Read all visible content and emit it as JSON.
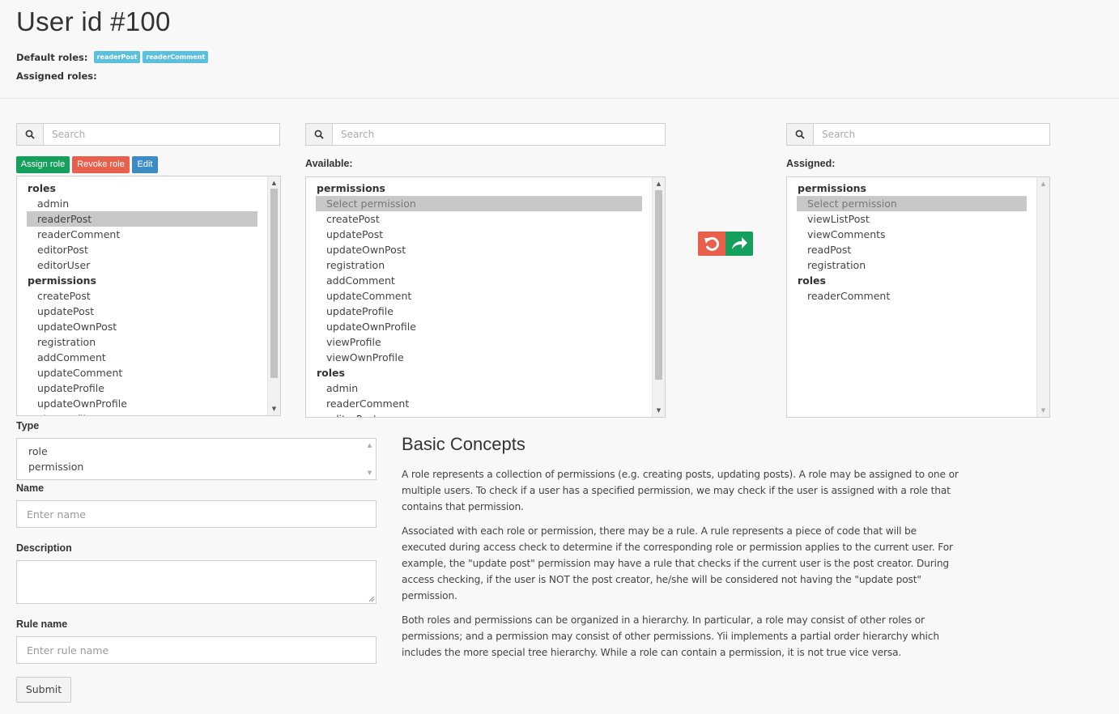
{
  "page": {
    "title": "User id #100",
    "default_roles_label": "Default roles:",
    "default_roles": [
      "readerPost",
      "readerComment"
    ],
    "assigned_roles_label": "Assigned roles:"
  },
  "left_panel": {
    "search_placeholder": "Search",
    "buttons": {
      "assign": "Assign role",
      "revoke": "Revoke role",
      "edit": "Edit"
    },
    "groups": [
      {
        "label": "roles",
        "items": [
          "admin",
          "readerPost",
          "readerComment",
          "editorPost",
          "editorUser"
        ],
        "selected": "readerPost"
      },
      {
        "label": "permissions",
        "items": [
          "createPost",
          "updatePost",
          "updateOwnPost",
          "registration",
          "addComment",
          "updateComment",
          "updateProfile",
          "updateOwnProfile",
          "viewProfile"
        ]
      }
    ]
  },
  "available_panel": {
    "search_placeholder": "Search",
    "label": "Available:",
    "groups": [
      {
        "label": "permissions",
        "items": [
          "Select permission",
          "createPost",
          "updatePost",
          "updateOwnPost",
          "registration",
          "addComment",
          "updateComment",
          "updateProfile",
          "updateOwnProfile",
          "viewProfile",
          "viewOwnProfile"
        ],
        "selected": "Select permission"
      },
      {
        "label": "roles",
        "items": [
          "admin",
          "readerComment",
          "editorPost"
        ]
      }
    ]
  },
  "assigned_panel": {
    "search_placeholder": "Search",
    "label": "Assigned:",
    "groups": [
      {
        "label": "permissions",
        "items": [
          "Select permission",
          "viewListPost",
          "viewComments",
          "readPost",
          "registration"
        ],
        "selected": "Select permission"
      },
      {
        "label": "roles",
        "items": [
          "readerComment"
        ]
      }
    ]
  },
  "transfer": {
    "revoke_icon": "undo-icon",
    "assign_icon": "share-forward-icon",
    "revoke_color": "#e8604c",
    "assign_color": "#16a05d"
  },
  "form": {
    "type_label": "Type",
    "type_options": [
      "role",
      "permission"
    ],
    "name_label": "Name",
    "name_placeholder": "Enter name",
    "description_label": "Description",
    "rule_label": "Rule name",
    "rule_placeholder": "Enter rule name",
    "submit": "Submit"
  },
  "concepts": {
    "heading": "Basic Concepts",
    "paragraphs": [
      "A role represents a collection of permissions (e.g. creating posts, updating posts). A role may be assigned to one or multiple users. To check if a user has a specified permission, we may check if the user is assigned with a role that contains that permission.",
      "Associated with each role or permission, there may be a rule. A rule represents a piece of code that will be executed during access check to determine if the corresponding role or permission applies to the current user. For example, the \"update post\" permission may have a rule that checks if the current user is the post creator. During access checking, if the user is NOT the post creator, he/she will be considered not having the \"update post\" permission.",
      "Both roles and permissions can be organized in a hierarchy. In particular, a role may consist of other roles or permissions; and a permission may consist of other permissions. Yii implements a partial order hierarchy which includes the more special tree hierarchy. While a role can contain a permission, it is not true vice versa."
    ]
  },
  "colors": {
    "assign_btn": "#16a05d",
    "revoke_btn": "#e8604c",
    "edit_btn": "#3b8cc5",
    "badge": "#5bc0de"
  }
}
